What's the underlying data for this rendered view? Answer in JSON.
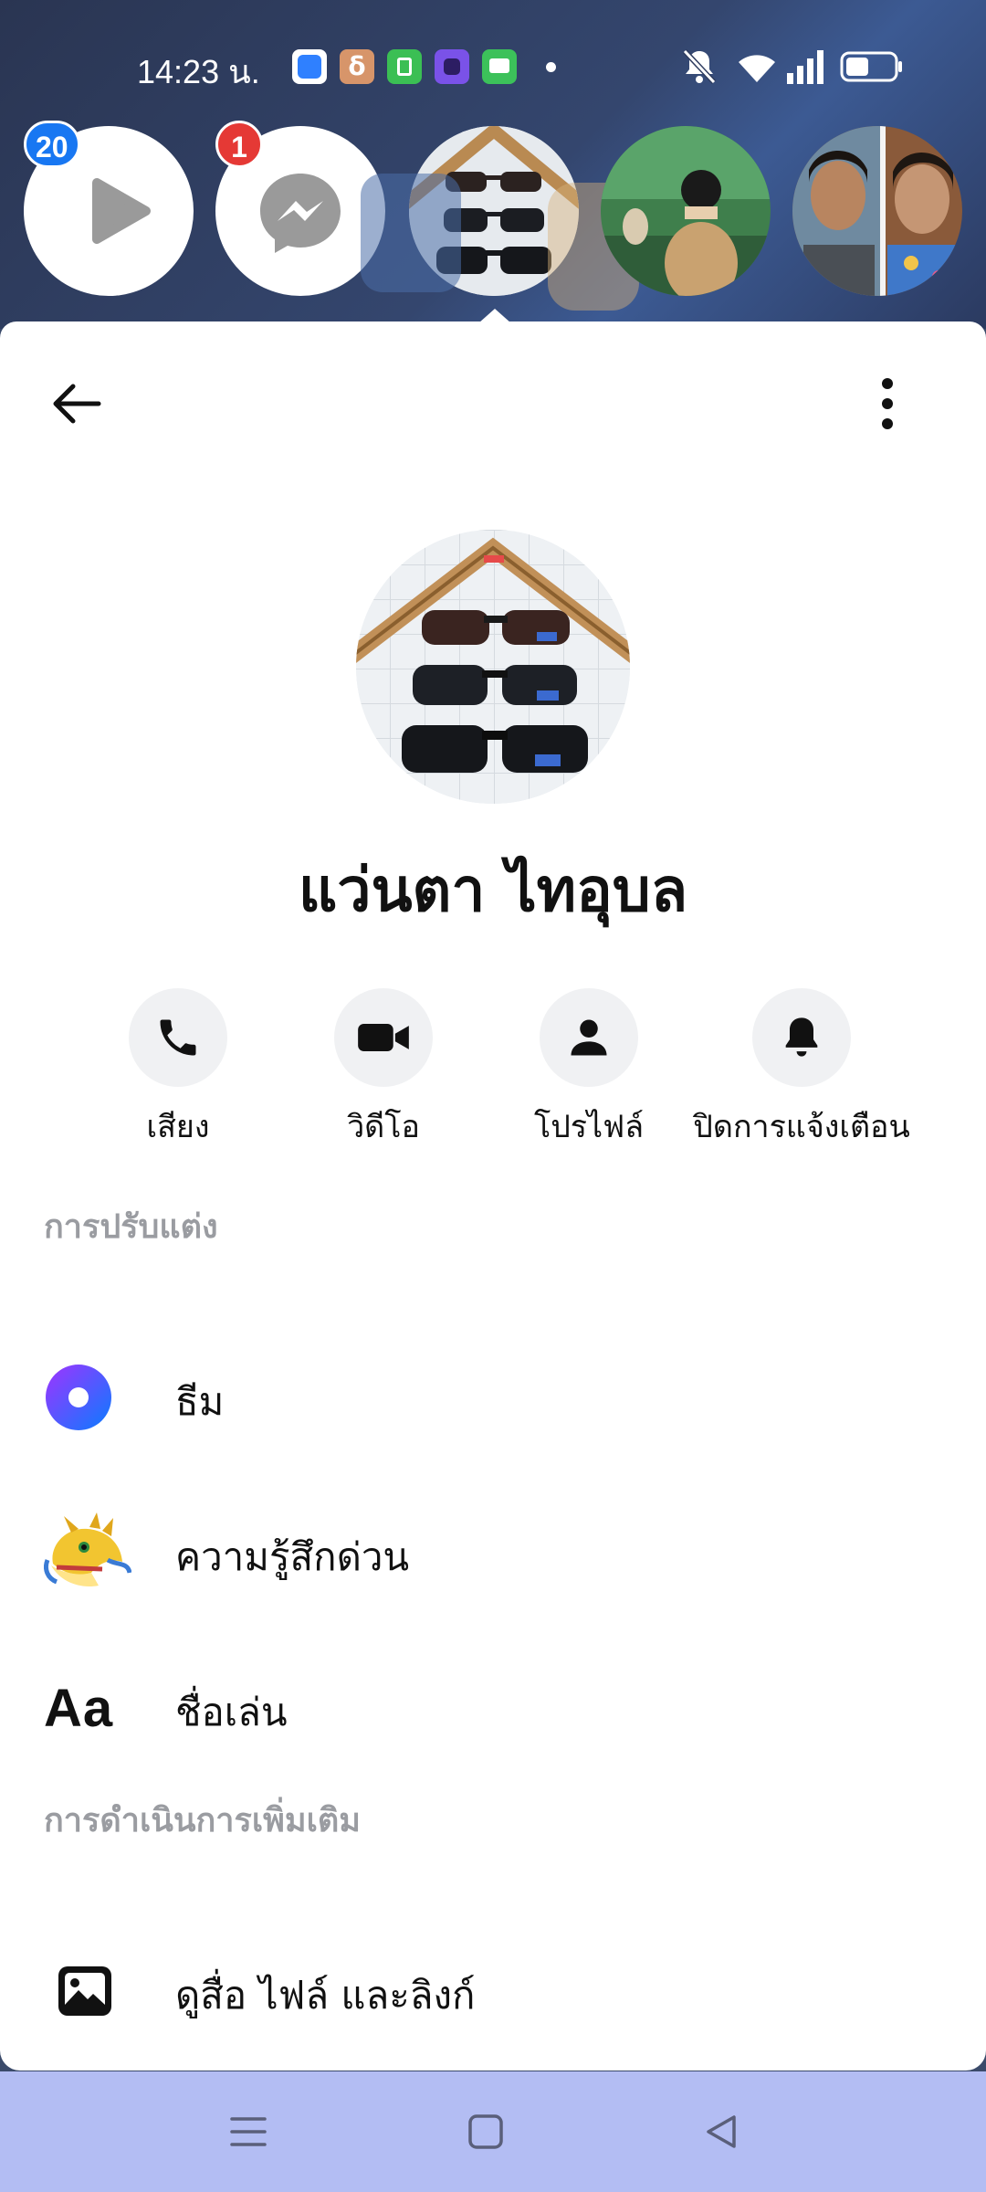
{
  "status_bar": {
    "time": "14:23 น.",
    "notification_icons": [
      "app-blue-icon",
      "app-s-icon",
      "app-shop-icon",
      "app-purple-icon",
      "app-chat-icon"
    ],
    "system_icons": [
      "mute-icon",
      "wifi-icon",
      "signal-icon",
      "battery-icon"
    ]
  },
  "chat_heads": {
    "video_badge": "20",
    "messenger_badge": "1"
  },
  "header": {
    "back_icon": "arrow-left-icon",
    "more_icon": "more-vertical-icon"
  },
  "profile": {
    "name": "แว่นตา ไทอุบล"
  },
  "actions": [
    {
      "label": "เสียง",
      "icon": "phone-icon"
    },
    {
      "label": "วิดีโอ",
      "icon": "video-icon"
    },
    {
      "label": "โปรไฟล์",
      "icon": "person-icon"
    },
    {
      "label": "ปิดการแจ้งเตือน",
      "icon": "bell-icon"
    }
  ],
  "sections": {
    "customize": {
      "title": "การปรับแต่ง",
      "items": [
        {
          "label": "ธีม",
          "icon": "theme-icon"
        },
        {
          "label": "ความรู้สึกด่วน",
          "icon": "dragon-emoji-icon"
        },
        {
          "label": "ชื่อเล่น",
          "icon": "text-aa-icon",
          "icon_text": "Aa"
        }
      ]
    },
    "more_actions": {
      "title": "การดำเนินการเพิ่มเติม",
      "items": [
        {
          "label": "ดูสื่อ ไฟล์ และลิงก์",
          "icon": "image-icon"
        }
      ]
    }
  },
  "colors": {
    "badge_blue": "#1877f2",
    "badge_red": "#e53935",
    "theme_gradient_start": "#a033ff",
    "theme_gradient_end": "#0a7cff",
    "nav_bar": "#b3bdf3"
  }
}
